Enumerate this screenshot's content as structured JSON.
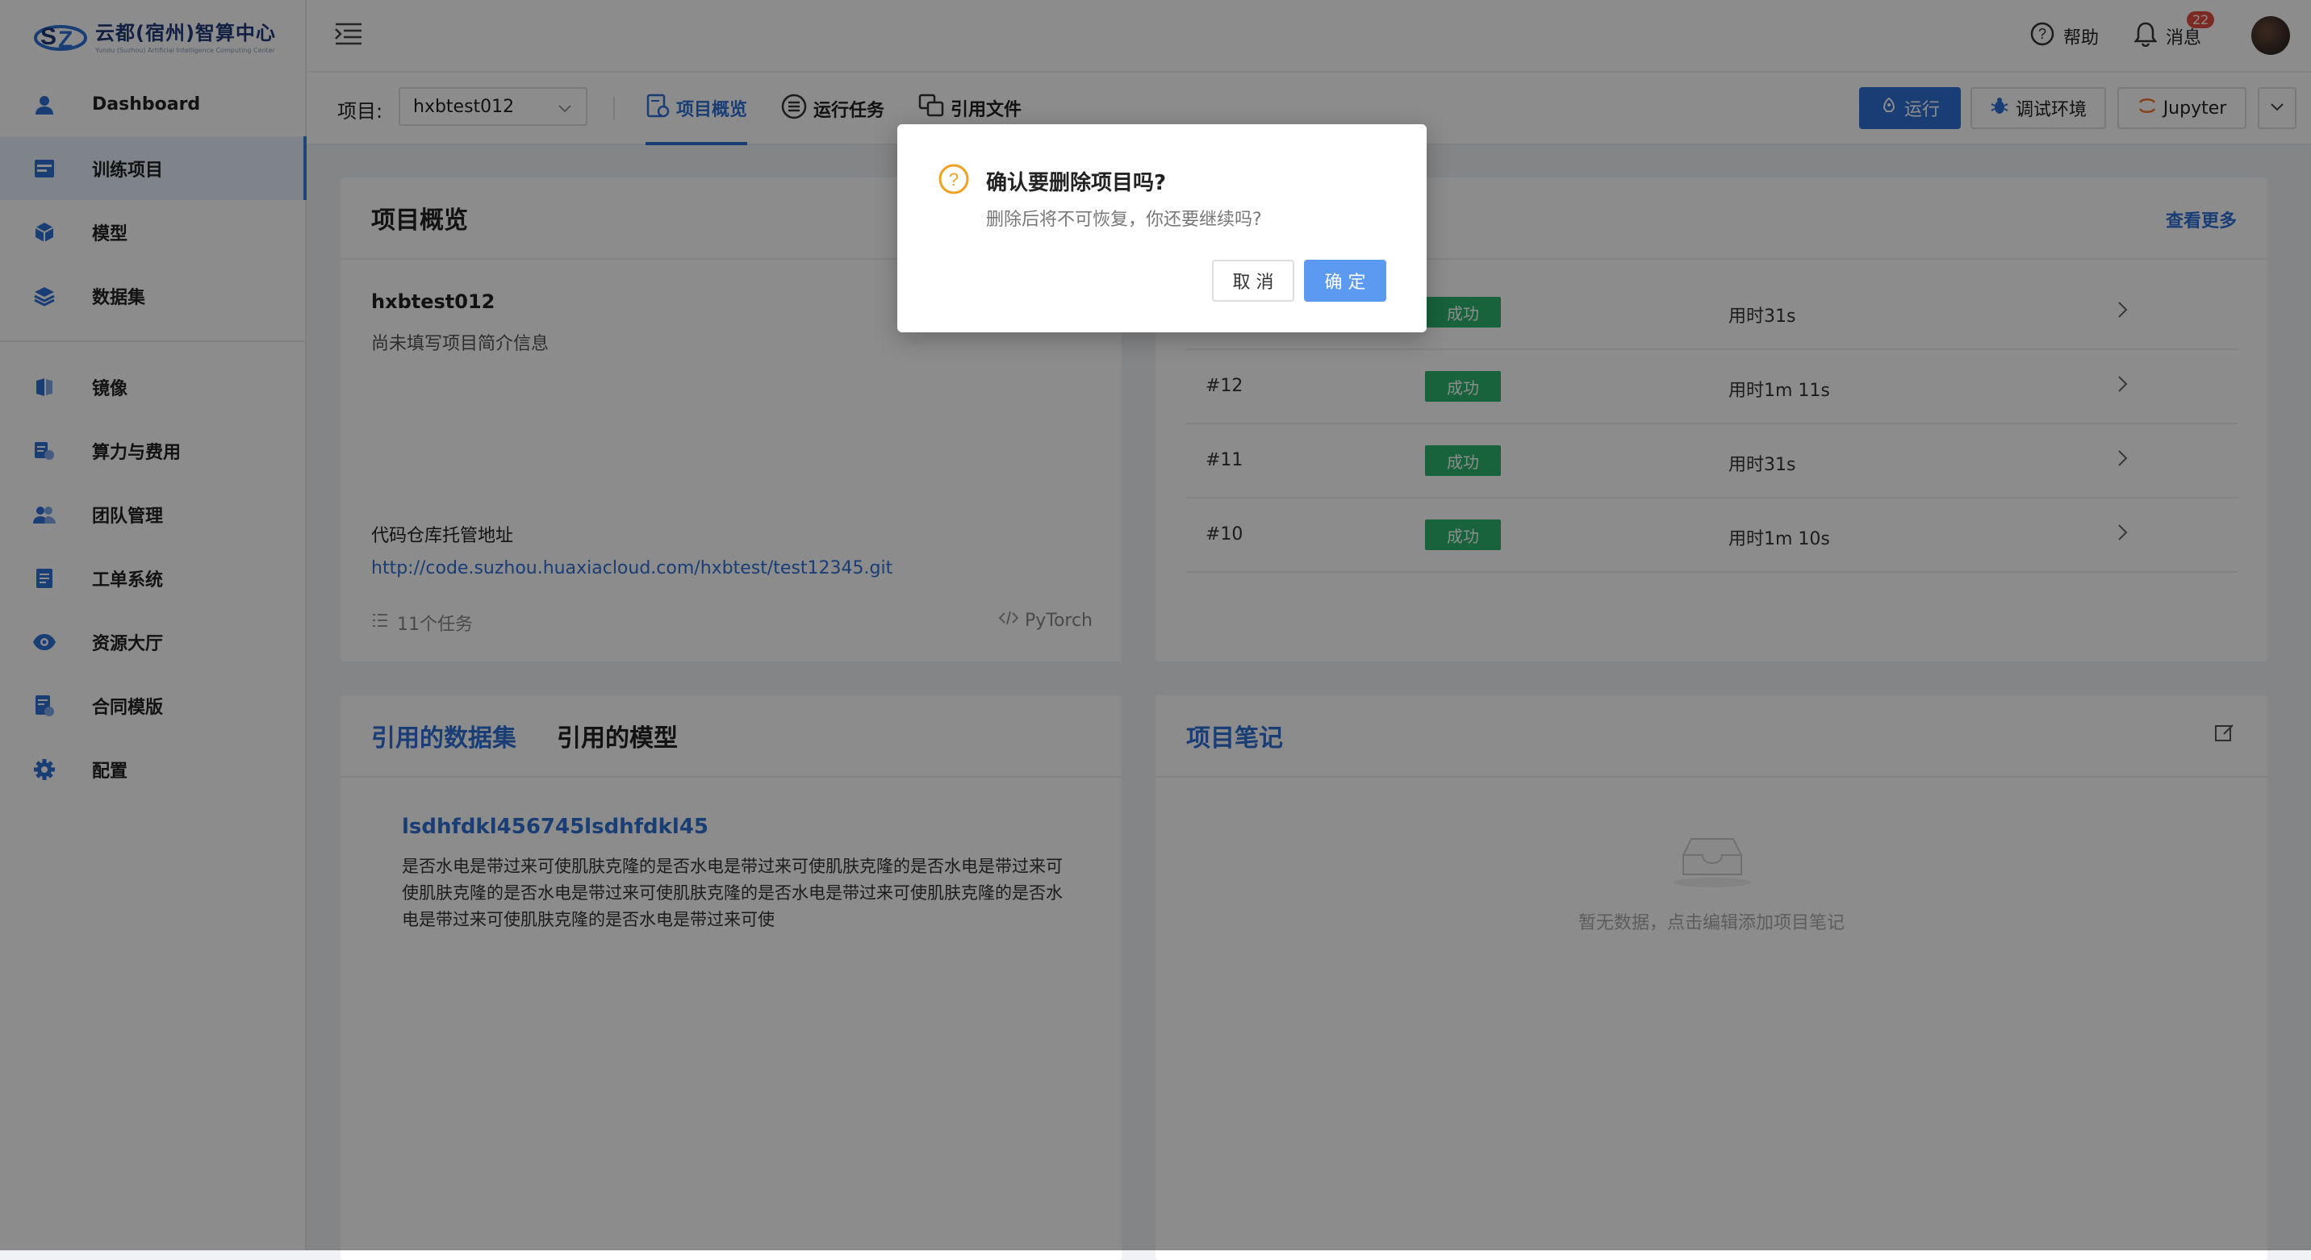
{
  "app": {
    "logo_title": "云都(宿州)智算中心",
    "logo_subtitle": "Yundu (Suzhou) Artificial Intelligence Computing Center"
  },
  "sidebar": {
    "items": [
      {
        "label": "Dashboard",
        "icon": "user-icon"
      },
      {
        "label": "训练项目",
        "icon": "project-icon",
        "active": true
      },
      {
        "label": "模型",
        "icon": "cube-icon"
      },
      {
        "label": "数据集",
        "icon": "layers-icon"
      },
      {
        "label": "镜像",
        "icon": "image-icon"
      },
      {
        "label": "算力与费用",
        "icon": "billing-icon"
      },
      {
        "label": "团队管理",
        "icon": "team-icon"
      },
      {
        "label": "工单系统",
        "icon": "ticket-icon"
      },
      {
        "label": "资源大厅",
        "icon": "eye-icon"
      },
      {
        "label": "合同模版",
        "icon": "contract-icon"
      },
      {
        "label": "配置",
        "icon": "gear-icon"
      }
    ]
  },
  "topbar": {
    "help_label": "帮助",
    "messages_label": "消息",
    "messages_count": "22"
  },
  "subbar": {
    "project_label": "项目:",
    "project_value": "hxbtest012",
    "tabs": [
      {
        "label": "项目概览",
        "active": true
      },
      {
        "label": "运行任务"
      },
      {
        "label": "引用文件"
      }
    ],
    "run_label": "运行",
    "debug_label": "调试环境",
    "jupyter_label": "Jupyter"
  },
  "overview": {
    "title": "项目概览",
    "project_name": "hxbtest012",
    "project_desc": "尚未填写项目简介信息",
    "repo_label": "代码仓库托管地址",
    "repo_url": "http://code.suzhou.huaxiacloud.com/hxbtest/test12345.git",
    "task_count": "11个任务",
    "framework": "PyTorch"
  },
  "runs": {
    "view_more": "查看更多",
    "rows": [
      {
        "num": "",
        "status": "成功",
        "duration": "用时31s"
      },
      {
        "num": "#12",
        "status": "成功",
        "duration": "用时1m 11s"
      },
      {
        "num": "#11",
        "status": "成功",
        "duration": "用时31s"
      },
      {
        "num": "#10",
        "status": "成功",
        "duration": "用时1m 10s"
      }
    ]
  },
  "refs": {
    "tab_datasets": "引用的数据集",
    "tab_models": "引用的模型",
    "dataset_name": "lsdhfdkl456745lsdhfdkl45",
    "dataset_desc": "是否水电是带过来可使肌肤克隆的是否水电是带过来可使肌肤克隆的是否水电是带过来可使肌肤克隆的是否水电是带过来可使肌肤克隆的是否水电是带过来可使肌肤克隆的是否水电是带过来可使肌肤克隆的是否水电是带过来可使"
  },
  "notes": {
    "title": "项目笔记",
    "empty_text": "暂无数据，点击编辑添加项目笔记"
  },
  "modal": {
    "title": "确认要删除项目吗?",
    "body": "删除后将不可恢复，你还要继续吗?",
    "cancel_label": "取 消",
    "ok_label": "确 定"
  },
  "colors": {
    "primary": "#2f6fd6",
    "success": "#2db36e",
    "warning": "#f0a020",
    "badge": "#e54d42"
  }
}
